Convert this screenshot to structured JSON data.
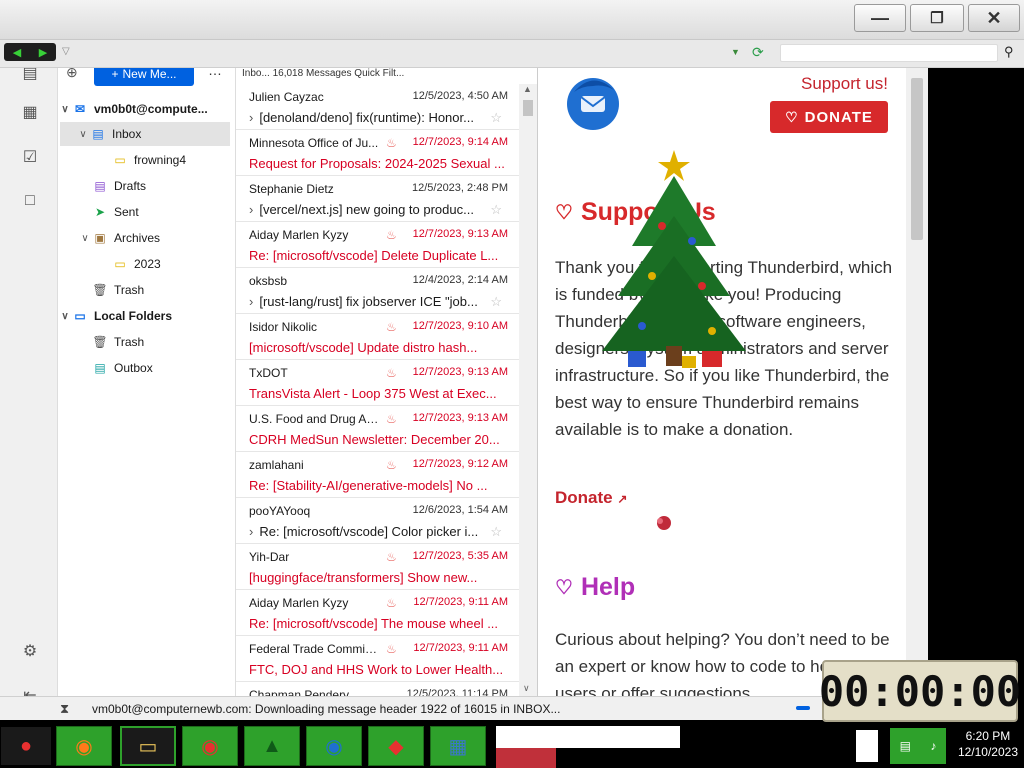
{
  "window": {
    "minimize_icon": "minimize-icon",
    "restore_icon": "restore-icon",
    "close_icon": "close-icon"
  },
  "folders": {
    "new_message_label": "New Me...",
    "account": "vm0b0t@compute...",
    "items": [
      {
        "label": "Inbox",
        "icon": "inbox-icon",
        "level": 1,
        "selected": true
      },
      {
        "label": "frowning4",
        "icon": "folder-icon",
        "level": 2
      },
      {
        "label": "Drafts",
        "icon": "drafts-icon",
        "level": 1
      },
      {
        "label": "Sent",
        "icon": "sent-icon",
        "level": 1
      },
      {
        "label": "Archives",
        "icon": "archive-icon",
        "level": 1
      },
      {
        "label": "2023",
        "icon": "folder-icon",
        "level": 2
      },
      {
        "label": "Trash",
        "icon": "trash-icon",
        "level": 1
      }
    ],
    "local_folders": "Local Folders",
    "local_items": [
      {
        "label": "Trash",
        "icon": "trash-icon"
      },
      {
        "label": "Outbox",
        "icon": "outbox-icon"
      }
    ]
  },
  "message_list": {
    "header": "Inbo...   16,018 Messages   Quick Filt...",
    "messages": [
      {
        "from": "Julien Cayzac",
        "date": "12/5/2023, 4:50 AM",
        "subject": "[denoland/deno] fix(runtime): Honor...",
        "unread": false
      },
      {
        "from": "Minnesota Office of Ju...",
        "date": "12/7/2023, 9:14 AM",
        "subject": "Request for Proposals: 2024-2025 Sexual ...",
        "unread": true
      },
      {
        "from": "Stephanie Dietz",
        "date": "12/5/2023, 2:48 PM",
        "subject": "[vercel/next.js] new going to produc...",
        "unread": false
      },
      {
        "from": "Aiday Marlen Kyzy",
        "date": "12/7/2023, 9:13 AM",
        "subject": "Re: [microsoft/vscode] Delete Duplicate L...",
        "unread": true
      },
      {
        "from": "oksbsb",
        "date": "12/4/2023, 2:14 AM",
        "subject": "[rust-lang/rust] fix jobserver ICE \"job...",
        "unread": false
      },
      {
        "from": "Isidor Nikolic",
        "date": "12/7/2023, 9:10 AM",
        "subject": "[microsoft/vscode] Update distro hash...",
        "unread": true
      },
      {
        "from": "TxDOT",
        "date": "12/7/2023, 9:13 AM",
        "subject": "TransVista Alert - Loop 375 West at Exec...",
        "unread": true
      },
      {
        "from": "U.S. Food and Drug Ad...",
        "date": "12/7/2023, 9:13 AM",
        "subject": "CDRH MedSun Newsletter: December 20...",
        "unread": true
      },
      {
        "from": "zamlahani",
        "date": "12/7/2023, 9:12 AM",
        "subject": "Re: [Stability-AI/generative-models] No ...",
        "unread": true
      },
      {
        "from": "pooYAYooq",
        "date": "12/6/2023, 1:54 AM",
        "subject": "Re: [microsoft/vscode] Color picker i...",
        "unread": false
      },
      {
        "from": "Yih-Dar",
        "date": "12/7/2023, 5:35 AM",
        "subject": "[huggingface/transformers] Show new...",
        "unread": true
      },
      {
        "from": "Aiday Marlen Kyzy",
        "date": "12/7/2023, 9:11 AM",
        "subject": "Re: [microsoft/vscode] The mouse wheel ...",
        "unread": true
      },
      {
        "from": "Federal Trade Commiss...",
        "date": "12/7/2023, 9:11 AM",
        "subject": "FTC, DOJ and HHS Work to Lower Health...",
        "unread": true
      },
      {
        "from": "Chapman Pendery",
        "date": "12/5/2023, 11:14 PM",
        "subject": "",
        "unread": false
      }
    ]
  },
  "content": {
    "support_us": "Support us!",
    "donate_button": "DONATE",
    "support_heading": "Support Us",
    "support_text": "Thank you for supporting Thunderbird, which is funded by users like you! Producing Thunderbird requires software engineers, designers, system administrators and server infrastructure. So if you like Thunderbird, the best way to ensure Thunderbird remains available is to make a donation.",
    "donate_link": "Donate",
    "help_heading": "Help",
    "help_text": "Curious about helping? You don’t need to be an expert or know how to code to help other users or offer suggestions."
  },
  "status": {
    "text": "vm0b0t@computernewb.com: Downloading message header 1922 of 16015 in INBOX..."
  },
  "timer": {
    "value": "00:00:00"
  },
  "taskbar": {
    "items": [
      "santa-icon",
      "firefox-icon",
      "file-explorer-icon",
      "chrome-icon",
      "christmas-tree-icon",
      "thunderbird-icon",
      "anydesk-icon",
      "control-panel-icon"
    ],
    "time": "6:20 PM",
    "date": "12/10/2023"
  },
  "colors": {
    "accent": "#0061e0",
    "unread": "#d70022",
    "donate": "#d7292b",
    "taskbar_item": "#2ea12b"
  }
}
